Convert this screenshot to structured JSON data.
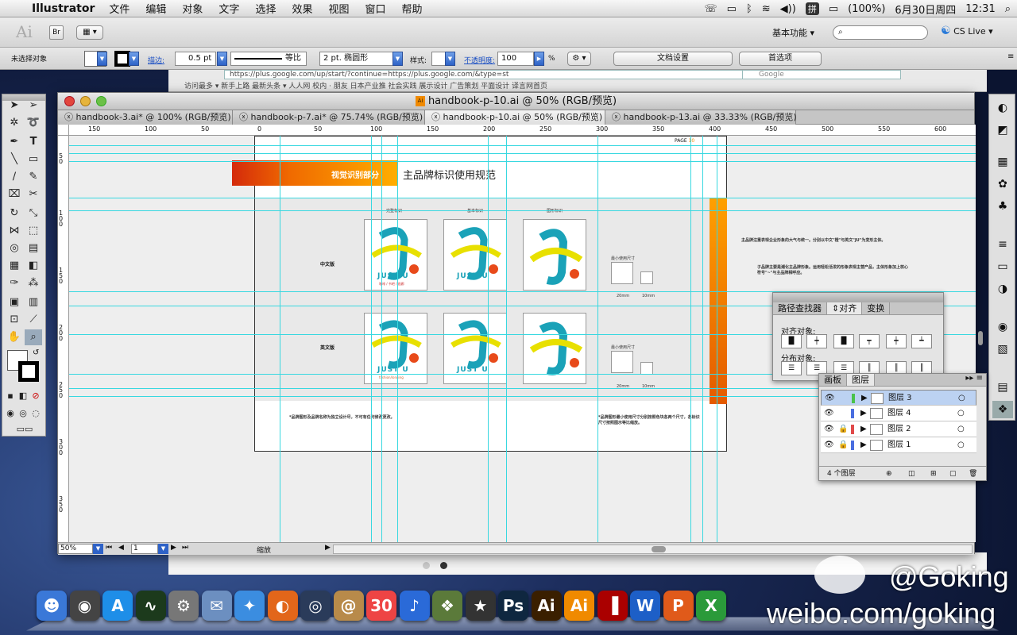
{
  "menubar": {
    "apple": "",
    "app_name": "Illustrator",
    "menus": [
      "文件",
      "编辑",
      "对象",
      "文字",
      "选择",
      "效果",
      "视图",
      "窗口",
      "帮助"
    ],
    "battery": "(100%)",
    "date": "6月30日周四",
    "time": "12:31",
    "ime": "拼"
  },
  "controlbar": {
    "ai_logo": "Ai",
    "br_label": "Br",
    "workspace": "基本功能",
    "cs_live": "CS Live"
  },
  "options": {
    "selection": "未选择对象",
    "stroke_label": "描边:",
    "stroke_weight": "0.5 pt",
    "stroke_profile": "等比",
    "brush": "2 pt. 椭圆形",
    "style_label": "样式:",
    "opacity_label": "不透明度:",
    "opacity_value": "100",
    "percent": "%",
    "doc_setup": "文档设置",
    "preferences": "首选项"
  },
  "browser_behind": {
    "url": "https://plus.google.com/up/start/?continue=https://plus.google.com/&type=st",
    "search": "Google",
    "bookmarks": "访问最多 ▾   新手上路   最新头条 ▾   人人网 校内 · 朋友   日本产业推   社会实践   展示设计   广告策划   平面设计   译言网首页"
  },
  "document": {
    "title": "handbook-p-10.ai @ 50% (RGB/预览)",
    "tabs": [
      {
        "label": "handbook-3.ai* @ 100% (RGB/预览)",
        "active": false
      },
      {
        "label": "handbook-p-7.ai* @ 75.74% (RGB/预览)",
        "active": false
      },
      {
        "label": "handbook-p-10.ai @ 50% (RGB/预览)",
        "active": true
      },
      {
        "label": "handbook-p-13.ai @ 33.33% (RGB/预览)",
        "active": false
      }
    ],
    "hruler_ticks": [
      "150",
      "100",
      "50",
      "0",
      "50",
      "100",
      "150",
      "200",
      "250",
      "300",
      "350",
      "400",
      "450",
      "500",
      "550",
      "600"
    ],
    "vruler_ticks": [
      "50",
      "100",
      "150",
      "200",
      "250",
      "300",
      "350"
    ],
    "zoom": "50%",
    "page": "1",
    "status": "缩放"
  },
  "artwork": {
    "page_label": "PAGE",
    "page_number": "10",
    "section_label": "视觉识别部分",
    "heading": "主品牌标识使用规范",
    "col_headers": [
      "完整标识",
      "基本标识",
      "图形标识"
    ],
    "row_cn": "中文版",
    "row_en": "英文版",
    "min_size": "最小使用尺寸",
    "mm20": "20mm",
    "mm10": "10mm",
    "desc1": "主品牌注重表现企业形象的大气与统一。分别以中文\"橙\"与英文\"JU\"为变形主体。",
    "desc2": "子品牌主要是潮化主品牌形象。运用轻松活泼的形象表现主营产品，主体形象加上核心符号\"~\"与主品牌相呼应。",
    "note_left": "*品牌图形及品牌名称为独立设计尽，不可有任何修改更改。",
    "note_right": "*品牌图形最小使用尺寸分别按照色块各两个尺寸，各标识尺寸按照图示等比缩放。",
    "logo_text": "JUST U",
    "cn_sub": "咖啡 / 书吧 / 画廊",
    "en_sub": "fashion/longing"
  },
  "align_panel": {
    "tabs": [
      "路径查找器",
      "对齐",
      "变换"
    ],
    "align_objects": "对齐对象:",
    "distribute_objects": "分布对象:"
  },
  "layers_panel": {
    "tabs": [
      "画板",
      "图层"
    ],
    "layers": [
      {
        "name": "图层 3",
        "color": "#4bc24b",
        "selected": true
      },
      {
        "name": "图层 4",
        "color": "#4a6ee0",
        "selected": false
      },
      {
        "name": "图层 2",
        "color": "#e04a4a",
        "selected": false
      },
      {
        "name": "图层 1",
        "color": "#4a6ee0",
        "selected": false
      }
    ],
    "count": "4 个图层"
  },
  "dock": {
    "apps": [
      {
        "name": "Finder",
        "glyph": "☻",
        "color": "#3a78d8"
      },
      {
        "name": "Dashboard",
        "glyph": "◉",
        "color": "#444"
      },
      {
        "name": "App Store",
        "glyph": "A",
        "color": "#1e8ee8"
      },
      {
        "name": "Activity Monitor",
        "glyph": "∿",
        "color": "#1c3a1c"
      },
      {
        "name": "System Preferences",
        "glyph": "⚙",
        "color": "#777"
      },
      {
        "name": "Mail",
        "glyph": "✉",
        "color": "#6c8fc0"
      },
      {
        "name": "Safari",
        "glyph": "✦",
        "color": "#3b8de0"
      },
      {
        "name": "Firefox",
        "glyph": "◐",
        "color": "#e2661a"
      },
      {
        "name": "QuickTime",
        "glyph": "◎",
        "color": "#2a3b5a"
      },
      {
        "name": "Address Book",
        "glyph": "@",
        "color": "#b88a4a"
      },
      {
        "name": "iCal",
        "glyph": "30",
        "color": "#e44"
      },
      {
        "name": "iTunes",
        "glyph": "♪",
        "color": "#2a6ad8"
      },
      {
        "name": "iPhoto",
        "glyph": "❖",
        "color": "#5b7a3a"
      },
      {
        "name": "iMovie",
        "glyph": "★",
        "color": "#333"
      },
      {
        "name": "Photoshop",
        "glyph": "Ps",
        "color": "#0f2740"
      },
      {
        "name": "Illustrator",
        "glyph": "Ai",
        "color": "#3a1f00"
      },
      {
        "name": "Illustrator CS5",
        "glyph": "Ai",
        "color": "#f08a00"
      },
      {
        "name": "Flash",
        "glyph": "▐",
        "color": "#a00"
      },
      {
        "name": "Word",
        "glyph": "W",
        "color": "#1d5fc7"
      },
      {
        "name": "PowerPoint",
        "glyph": "P",
        "color": "#e05a1a"
      },
      {
        "name": "Excel",
        "glyph": "X",
        "color": "#2a9a3a"
      }
    ]
  },
  "watermark": {
    "line1": "@Goking",
    "line2": "weibo.com/goking"
  }
}
